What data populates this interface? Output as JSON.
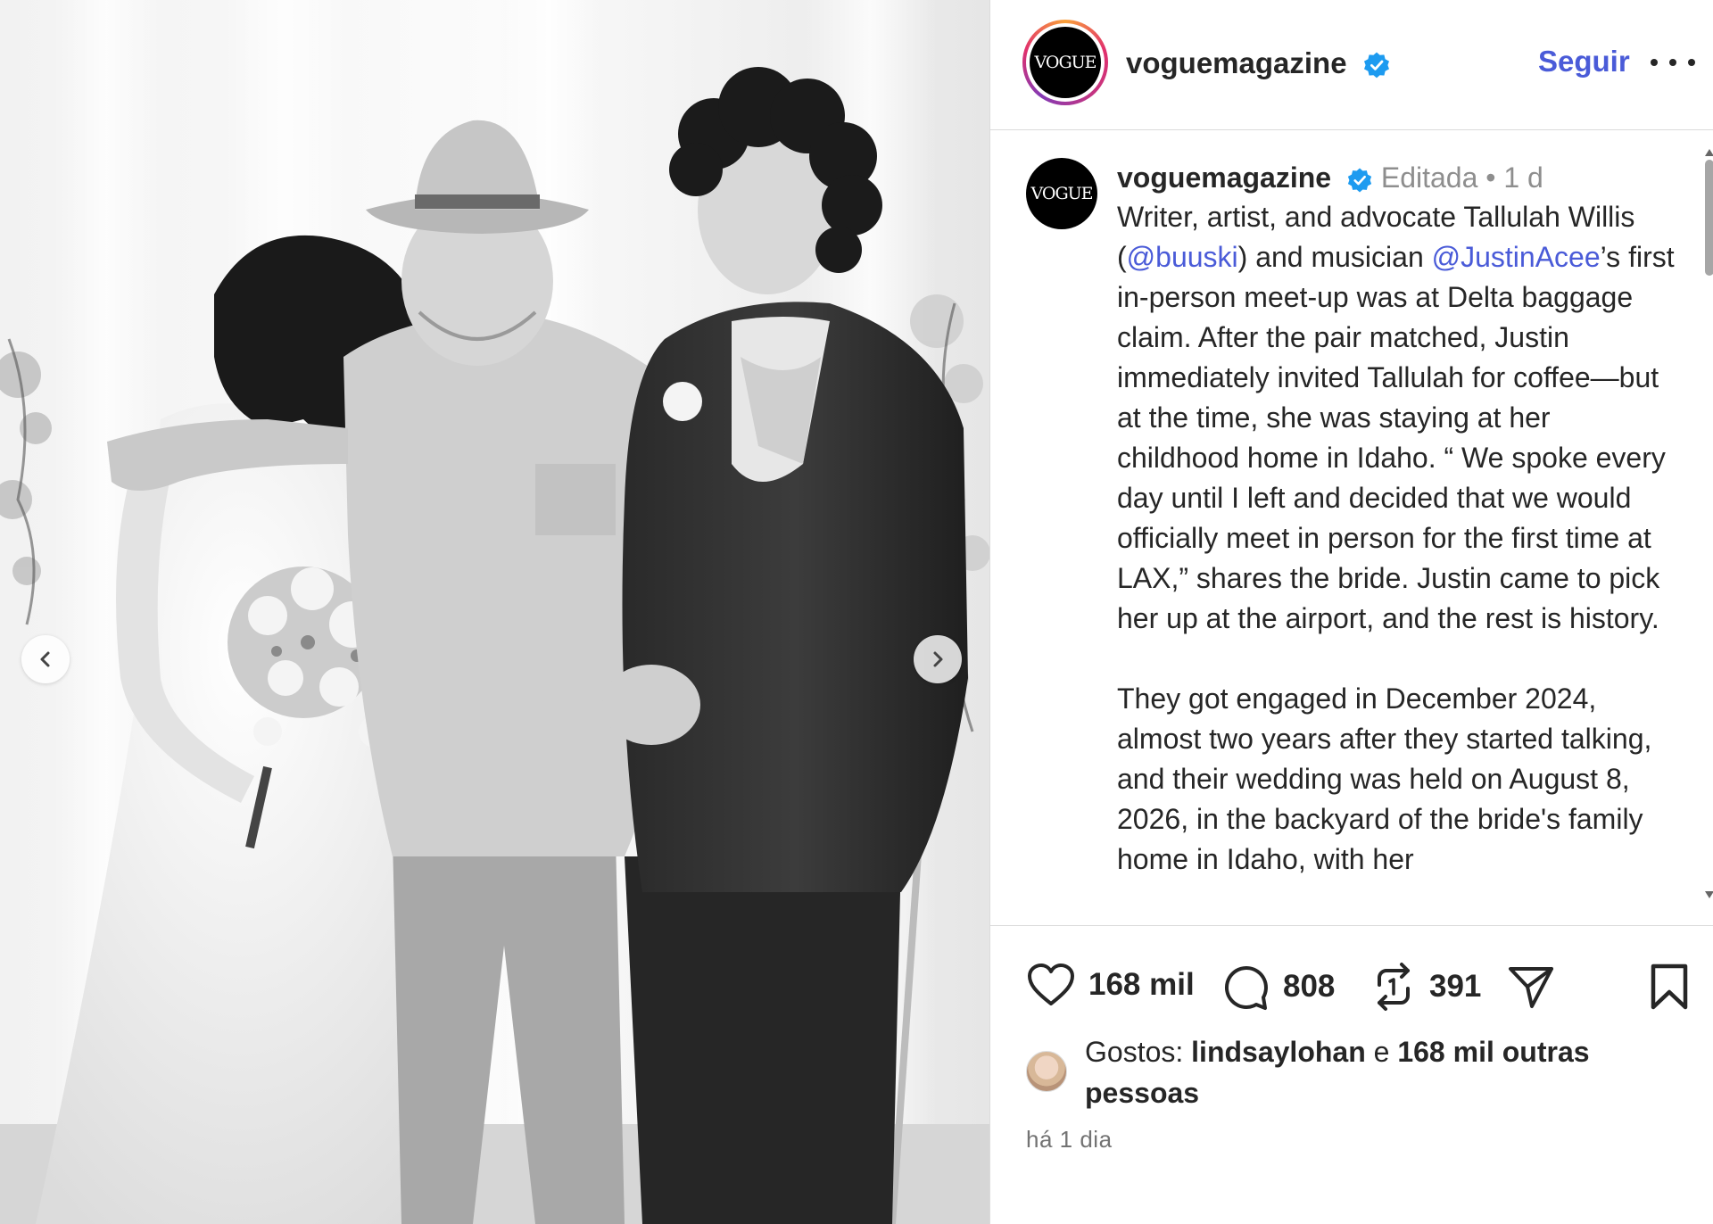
{
  "post": {
    "header": {
      "avatar_text": "VOGUE",
      "username": "voguemagazine",
      "follow_label": "Seguir"
    },
    "caption": {
      "avatar_text": "VOGUE",
      "username": "voguemagazine",
      "edited_label": "Editada",
      "separator": "•",
      "time": "1 d",
      "p1_a": "Writer, artist, and advocate Tallulah Willis (",
      "mention_1": "@buuski",
      "p1_b": ") and musician ",
      "mention_2": "@JustinAcee",
      "p1_c": "’s first in-person meet-up was at Delta baggage claim. After the pair matched, Justin immediately invited Tallulah for coffee—but at the time, she was staying at her childhood home in Idaho. “ We spoke every day until I left and decided that we would officially meet in person for the first time at LAX,” shares the bride. Justin came to pick her up at the airport, and the rest is history.",
      "p2": "They got engaged in December 2024, almost two years after they started talking, and their wedding was held on August 8, 2026, in the backyard of the bride's family home in Idaho, with her"
    },
    "actions": {
      "likes_count": "168 mil",
      "comments_count": "808",
      "reposts_count": "391"
    },
    "likes": {
      "prefix": "Gostos:",
      "user": "lindsaylohan",
      "connector": "e",
      "others": "168 mil outras pessoas"
    },
    "time_ago": "há 1 dia"
  },
  "icons": {
    "verified": "verified-badge-icon",
    "more": "more-options-icon",
    "like": "heart-icon",
    "comment": "comment-bubble-icon",
    "repost": "repost-icon",
    "share": "send-icon",
    "save": "bookmark-icon",
    "prev": "chevron-left-icon",
    "next": "chevron-right-icon"
  },
  "colors": {
    "link": "#4a5bd8",
    "verified": "#1d9bf0",
    "text": "#262626",
    "muted": "#8e8e8e"
  }
}
